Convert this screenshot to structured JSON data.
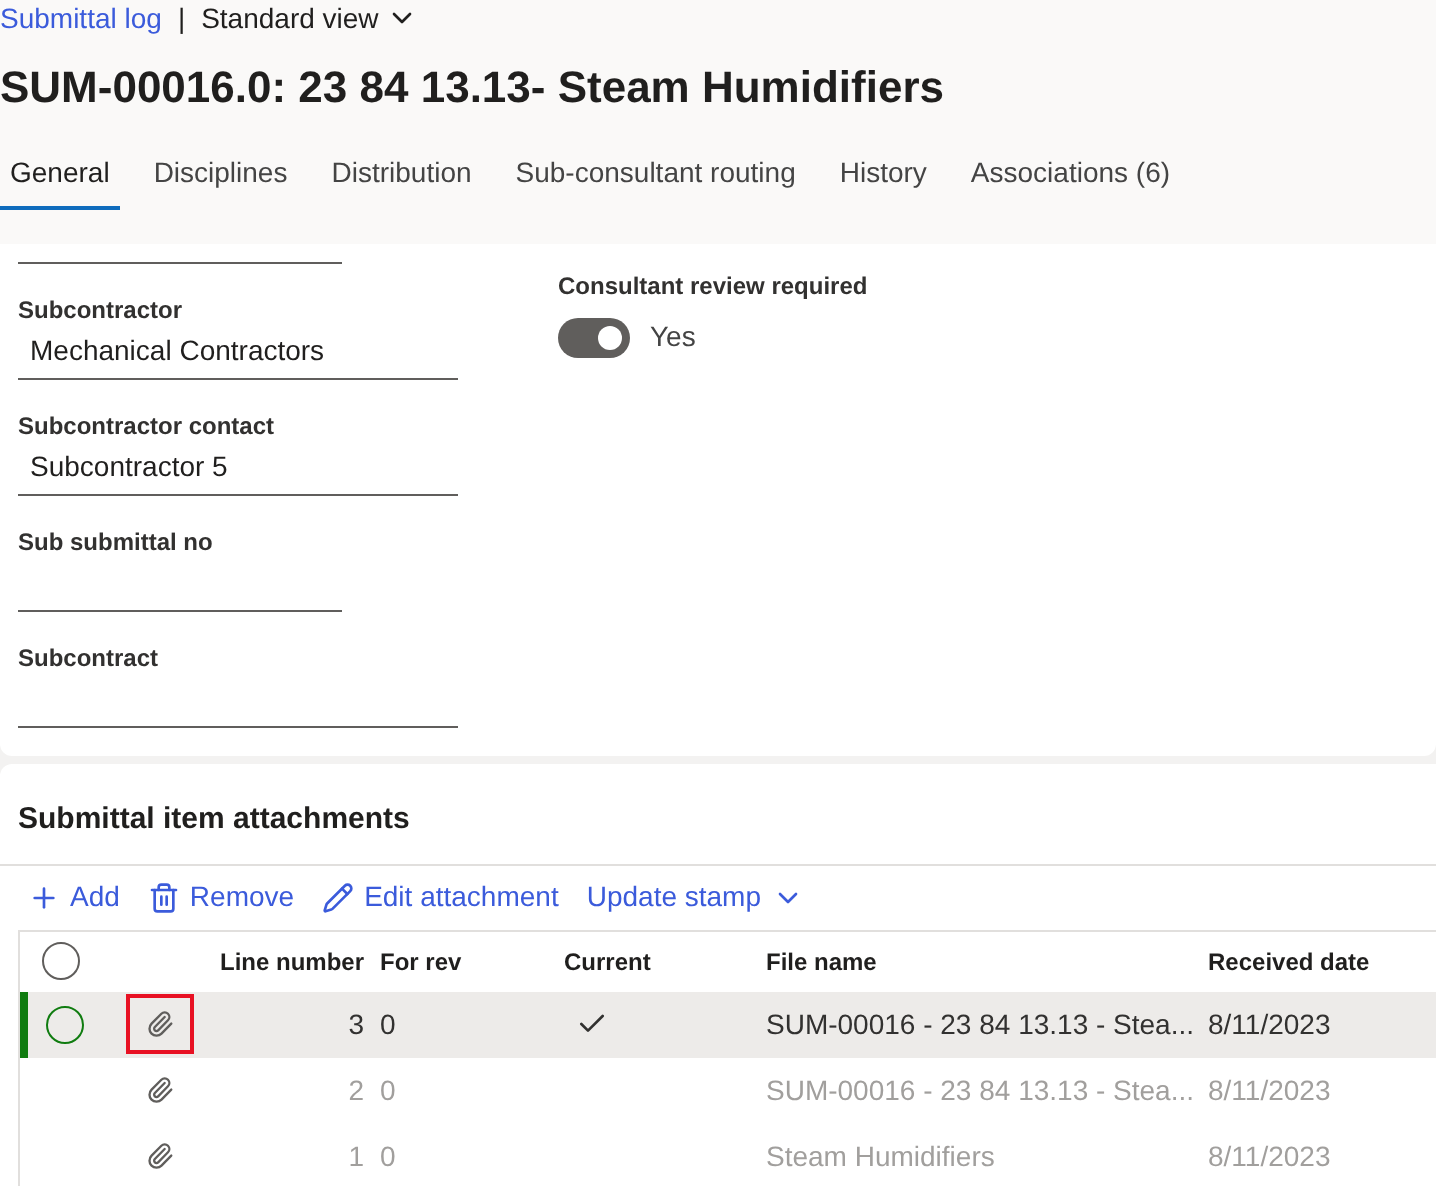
{
  "breadcrumb": {
    "link": "Submittal log",
    "separator": "|",
    "view": "Standard view"
  },
  "title": "SUM-00016.0: 23 84 13.13- Steam Humidifiers",
  "tabs": [
    {
      "label": "General",
      "selected": true
    },
    {
      "label": "Disciplines",
      "selected": false
    },
    {
      "label": "Distribution",
      "selected": false
    },
    {
      "label": "Sub-consultant routing",
      "selected": false
    },
    {
      "label": "History",
      "selected": false
    },
    {
      "label": "Associations (6)",
      "selected": false
    }
  ],
  "fields": [
    {
      "label": "Subcontractor",
      "value": "Mechanical Contractors",
      "wide": true
    },
    {
      "label": "Subcontractor contact",
      "value": "Subcontractor 5",
      "wide": true
    },
    {
      "label": "Sub submittal no",
      "wide": false
    },
    {
      "label": "Subcontract",
      "wide": true
    }
  ],
  "toggle": {
    "label": "Consultant review required",
    "on": true,
    "text": "Yes"
  },
  "attachments": {
    "title": "Submittal item attachments",
    "actions": [
      {
        "kind": "add",
        "label": "Add"
      },
      {
        "kind": "remove",
        "label": "Remove"
      },
      {
        "kind": "edit",
        "label": "Edit attachment"
      },
      {
        "kind": "menu",
        "label": "Update stamp"
      }
    ],
    "select_all": {
      "checked": false
    },
    "columns": [
      "Line number",
      "For rev",
      "Current",
      "File name",
      "Received date"
    ],
    "rows": [
      {
        "line": "3",
        "rev": "0",
        "current": true,
        "file": "SUM-00016 - 23 84 13.13 - Stea...",
        "date": "8/11/2023",
        "selected": true,
        "highlighted": true
      },
      {
        "line": "2",
        "rev": "0",
        "current": false,
        "file": "SUM-00016 - 23 84 13.13 - Stea...",
        "date": "8/11/2023",
        "selected": false,
        "highlighted": false
      },
      {
        "line": "1",
        "rev": "0",
        "current": false,
        "file": "Steam Humidifiers",
        "date": "8/11/2023",
        "selected": false,
        "highlighted": false
      }
    ]
  }
}
